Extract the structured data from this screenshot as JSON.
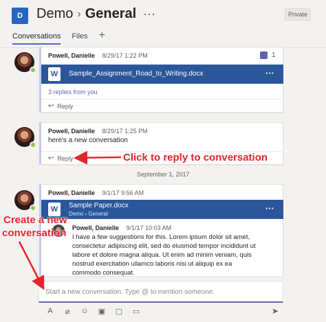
{
  "header": {
    "team_initial": "D",
    "team_name": "Demo",
    "chevron": "›",
    "channel_name": "General",
    "more": "···",
    "private_label": "Private"
  },
  "tabs": [
    {
      "label": "Conversations",
      "active": true
    },
    {
      "label": "Files",
      "active": false
    }
  ],
  "tab_add": "+",
  "messages": [
    {
      "author": "Powell, Danielle",
      "timestamp": "8/29/17 1:22 PM",
      "likes": "1",
      "file": {
        "name": "Sample_Assignment_Road_to_Writing.docx",
        "more": "···",
        "icon": "W"
      },
      "replies": "3 replies from you",
      "reply_label": "Reply"
    },
    {
      "author": "Powell, Danielle",
      "timestamp": "8/29/17 1:25 PM",
      "body": "here's a new conversation",
      "reply_label": "Reply"
    },
    {
      "author": "Powell, Danielle",
      "timestamp": "9/1/17 9:56 AM",
      "file": {
        "name": "Sample Paper.docx",
        "location": "Demo › General",
        "more": "···",
        "icon": "W"
      },
      "nested": {
        "author": "Powell, Danielle",
        "timestamp": "9/1/17 10:03 AM",
        "body_lines": [
          "I have a few suggestions for this. Lorem ipsum dolor sit amet,",
          "consectetur adipiscing elit, sed do eiusmod tempor incididunt ut",
          "labore et dolore magna aliqua. Ut enim ad minim veniam, quis",
          "nostrud exercitation ullamco laboris nisi ut aliquip ex ea",
          "commodo consequat."
        ]
      }
    }
  ],
  "date_separator": "September 1, 2017",
  "compose": {
    "placeholder": "Start a new conversation. Type @ to mention someone."
  },
  "toolbar_icons": [
    "format-icon",
    "attach-icon",
    "emoji-icon",
    "gif-icon",
    "sticker-icon",
    "meet-icon"
  ],
  "toolbar_glyphs": [
    "A",
    "⌀",
    "☺",
    "▣",
    "▢",
    "▭"
  ],
  "send_glyph": "➤",
  "annotations": {
    "reply": "Click to reply to conversation",
    "new_line1": "Create a new",
    "new_line2": "conversation"
  },
  "colors": {
    "accent": "#6264a7",
    "word_blue": "#2b579a",
    "annotation_red": "#e3252b",
    "presence_green": "#92c353"
  }
}
